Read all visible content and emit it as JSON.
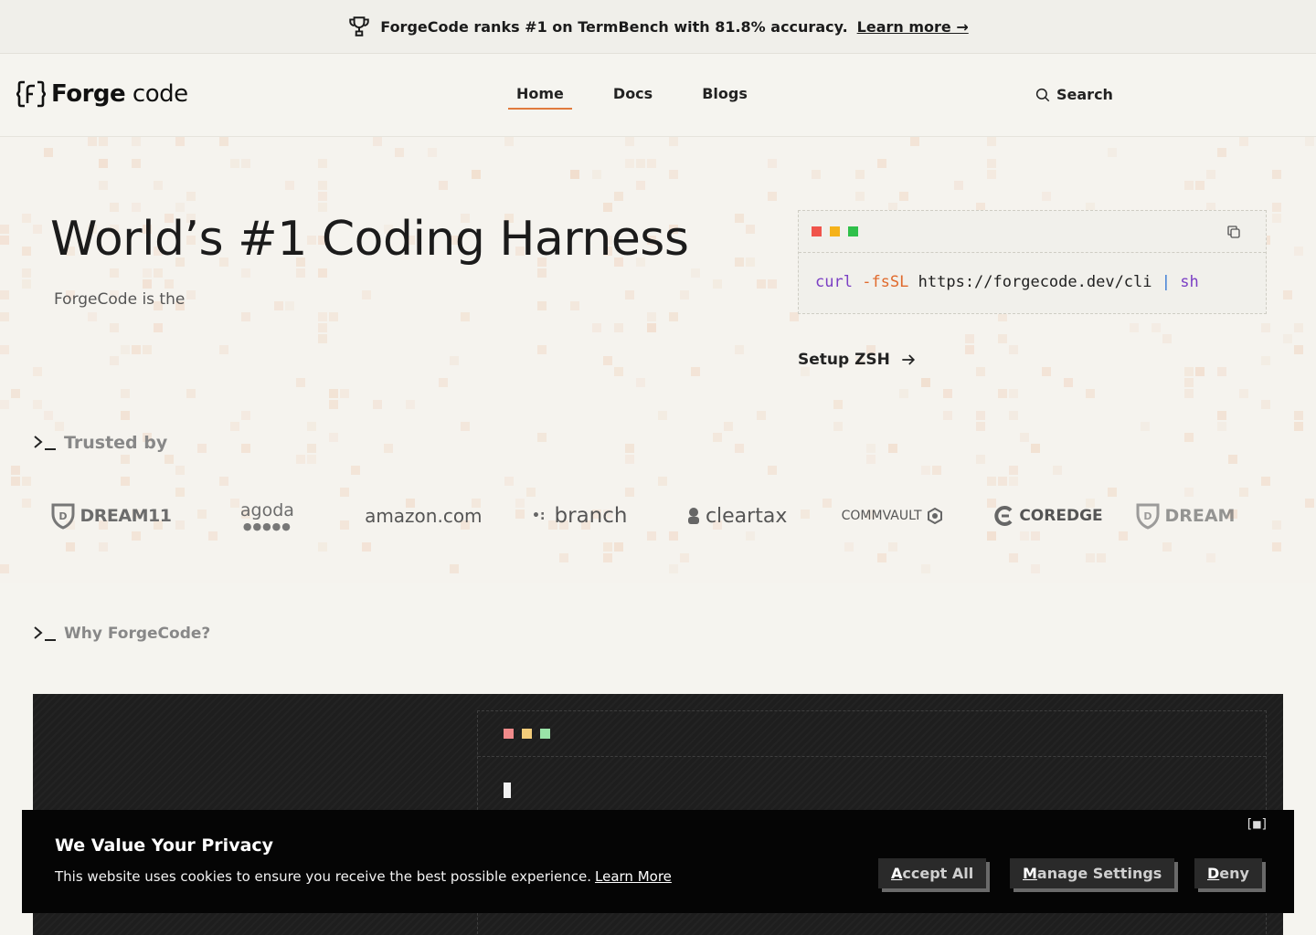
{
  "announcement": {
    "text": "ForgeCode ranks #1 on TermBench with 81.8% accuracy.",
    "link": "Learn more →",
    "icon": "trophy-icon"
  },
  "header": {
    "logo": {
      "forge": "Forge",
      "code": "code"
    },
    "nav": [
      {
        "label": "Home",
        "active": true
      },
      {
        "label": "Docs",
        "active": false
      },
      {
        "label": "Blogs",
        "active": false
      }
    ],
    "search_label": "Search"
  },
  "hero": {
    "title": "World’s #1 Coding Harness",
    "subtitle": "ForgeCode is the",
    "install": {
      "cmd": "curl",
      "flag": "-fsSL",
      "url": "https://forgecode.dev/cli",
      "pipe": "|",
      "shell": "sh"
    },
    "setup_label": "Setup ZSH"
  },
  "trusted": {
    "label": "Trusted by",
    "logos": [
      "DREAM11",
      "agoda",
      "amazon.com",
      "branch",
      "cleartax",
      "COMMVAULT",
      "COREDGE",
      "DREAM"
    ]
  },
  "why": {
    "label": "Why ForgeCode?"
  },
  "cookie": {
    "title": "We Value Your Privacy",
    "text": "This website uses cookies to ensure you receive the best possible experience.",
    "link": "Learn More",
    "close": "[■]",
    "accept": {
      "key": "A",
      "rest": "ccept All"
    },
    "manage": {
      "key": "M",
      "rest": "anage Settings"
    },
    "deny": {
      "key": "D",
      "rest": "eny"
    }
  },
  "colors": {
    "accent": "#e07a3c",
    "dot_red": "#f0544b",
    "dot_yellow": "#f5b21a",
    "dot_green": "#2fc04a"
  }
}
